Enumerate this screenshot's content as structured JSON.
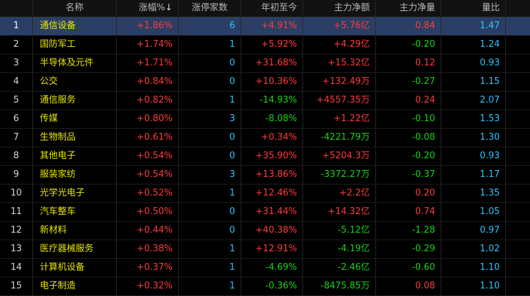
{
  "columns": {
    "index": "",
    "name": "名称",
    "change_pct": "涨幅%",
    "sort_indicator": "↓",
    "limit_up_count": "涨停家数",
    "ytd": "年初至今",
    "main_net_inflow": "主力净额",
    "main_net_volume": "主力净量",
    "volume_ratio": "量比"
  },
  "rows": [
    {
      "idx": "1",
      "name": "通信设备",
      "change": "+1.86%",
      "limit": "6",
      "ytd": "+4.91%",
      "flow": "+5.76亿",
      "net": "0.84",
      "vol": "1.47",
      "selected": true
    },
    {
      "idx": "2",
      "name": "国防军工",
      "change": "+1.74%",
      "limit": "1",
      "ytd": "+5.92%",
      "flow": "+4.29亿",
      "net": "-0.20",
      "vol": "1.24"
    },
    {
      "idx": "3",
      "name": "半导体及元件",
      "change": "+1.71%",
      "limit": "0",
      "ytd": "+31.68%",
      "flow": "+15.32亿",
      "net": "0.12",
      "vol": "0.93"
    },
    {
      "idx": "4",
      "name": "公交",
      "change": "+0.84%",
      "limit": "0",
      "ytd": "+10.36%",
      "flow": "+132.49万",
      "net": "-0.27",
      "vol": "1.15"
    },
    {
      "idx": "5",
      "name": "通信服务",
      "change": "+0.82%",
      "limit": "1",
      "ytd": "-14.93%",
      "flow": "+4557.35万",
      "net": "0.24",
      "vol": "2.07"
    },
    {
      "idx": "6",
      "name": "传媒",
      "change": "+0.80%",
      "limit": "3",
      "ytd": "-8.08%",
      "flow": "+1.22亿",
      "net": "-0.10",
      "vol": "1.53"
    },
    {
      "idx": "7",
      "name": "生物制品",
      "change": "+0.61%",
      "limit": "0",
      "ytd": "+0.34%",
      "flow": "-4221.79万",
      "net": "-0.08",
      "vol": "1.30"
    },
    {
      "idx": "8",
      "name": "其他电子",
      "change": "+0.54%",
      "limit": "0",
      "ytd": "+35.90%",
      "flow": "+5204.3万",
      "net": "-0.20",
      "vol": "0.93"
    },
    {
      "idx": "9",
      "name": "服装家纺",
      "change": "+0.54%",
      "limit": "3",
      "ytd": "+13.86%",
      "flow": "-3372.27万",
      "net": "-0.37",
      "vol": "1.17"
    },
    {
      "idx": "10",
      "name": "光学光电子",
      "change": "+0.52%",
      "limit": "1",
      "ytd": "+12.46%",
      "flow": "+2.2亿",
      "net": "0.20",
      "vol": "1.35"
    },
    {
      "idx": "11",
      "name": "汽车整车",
      "change": "+0.50%",
      "limit": "0",
      "ytd": "+31.44%",
      "flow": "+14.32亿",
      "net": "0.74",
      "vol": "1.05"
    },
    {
      "idx": "12",
      "name": "新材料",
      "change": "+0.44%",
      "limit": "0",
      "ytd": "+40.38%",
      "flow": "-5.12亿",
      "net": "-1.28",
      "vol": "0.97"
    },
    {
      "idx": "13",
      "name": "医疗器械服务",
      "change": "+0.38%",
      "limit": "1",
      "ytd": "+12.91%",
      "flow": "-4.19亿",
      "net": "-0.29",
      "vol": "1.02"
    },
    {
      "idx": "14",
      "name": "计算机设备",
      "change": "+0.37%",
      "limit": "1",
      "ytd": "-4.69%",
      "flow": "-2.46亿",
      "net": "-0.60",
      "vol": "1.10"
    },
    {
      "idx": "15",
      "name": "电子制造",
      "change": "+0.32%",
      "limit": "1",
      "ytd": "-0.36%",
      "flow": "-8475.85万",
      "net": "0.08",
      "vol": "1.10"
    }
  ],
  "colors": {
    "up": "#ff3b3b",
    "down": "#18d418",
    "name": "#e8e800",
    "cyan": "#2ac7ff",
    "selected_row": "#2b3f66"
  }
}
